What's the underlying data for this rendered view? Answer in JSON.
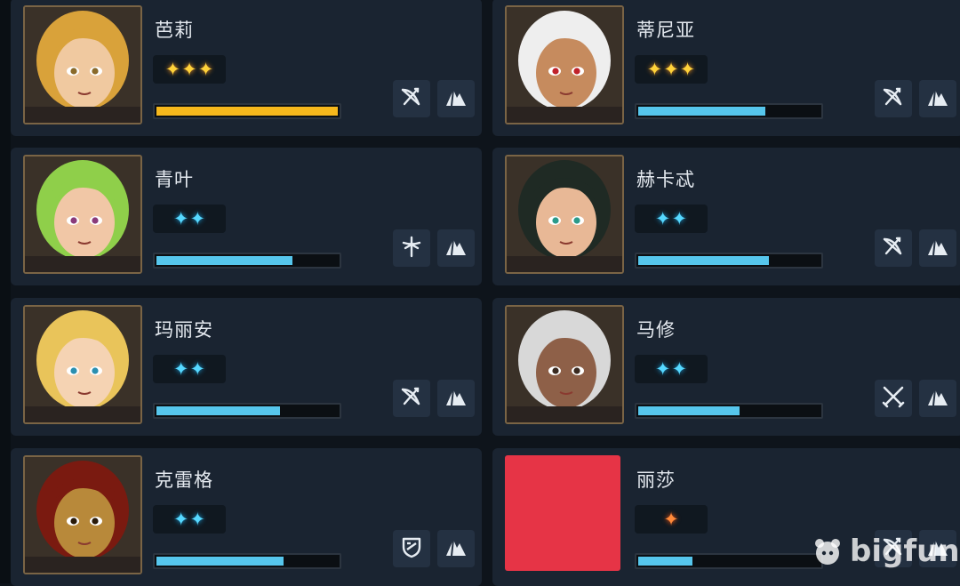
{
  "heroes": [
    {
      "name": "芭莉",
      "stars": 3,
      "star_color": "gold",
      "bar_fill": 1.0,
      "bar_color": "gold",
      "class_icon": "bow-icon",
      "skin": "#f0c9a0",
      "hair": "#d9a23a",
      "eye": "#8a6a2a"
    },
    {
      "name": "蒂尼亚",
      "stars": 3,
      "star_color": "gold",
      "bar_fill": 0.7,
      "bar_color": "blue",
      "class_icon": "bow-icon",
      "skin": "#c68b5e",
      "hair": "#eeeeee",
      "eye": "#c0222a"
    },
    {
      "name": "青叶",
      "stars": 2,
      "star_color": "blue",
      "bar_fill": 0.75,
      "bar_color": "blue",
      "class_icon": "staff-icon",
      "skin": "#f1c7a6",
      "hair": "#8fcf4a",
      "eye": "#8a3a7a"
    },
    {
      "name": "赫卡忒",
      "stars": 2,
      "star_color": "blue",
      "bar_fill": 0.72,
      "bar_color": "blue",
      "class_icon": "bow-icon",
      "skin": "#e8b896",
      "hair": "#1f2a24",
      "eye": "#2a9a8a"
    },
    {
      "name": "玛丽安",
      "stars": 2,
      "star_color": "blue",
      "bar_fill": 0.68,
      "bar_color": "blue",
      "class_icon": "bow-icon",
      "skin": "#f5d3b3",
      "hair": "#e9c45a",
      "eye": "#2a8fb0"
    },
    {
      "name": "马修",
      "stars": 2,
      "star_color": "blue",
      "bar_fill": 0.56,
      "bar_color": "blue",
      "class_icon": "crossed-swords-icon",
      "skin": "#8e6048",
      "hair": "#d8d8d8",
      "eye": "#3a2a20"
    },
    {
      "name": "克雷格",
      "stars": 2,
      "star_color": "blue",
      "bar_fill": 0.7,
      "bar_color": "blue",
      "class_icon": "shield-icon",
      "skin": "#b8893a",
      "hair": "#7a1a10",
      "eye": "#2a1a08"
    },
    {
      "name": "丽莎",
      "stars": 1,
      "star_color": "orange",
      "bar_fill": 0.3,
      "bar_color": "blue",
      "class_icon": "bow-icon",
      "redacted": true,
      "redact_color": "#e63446"
    }
  ],
  "watermark": "bigfun"
}
